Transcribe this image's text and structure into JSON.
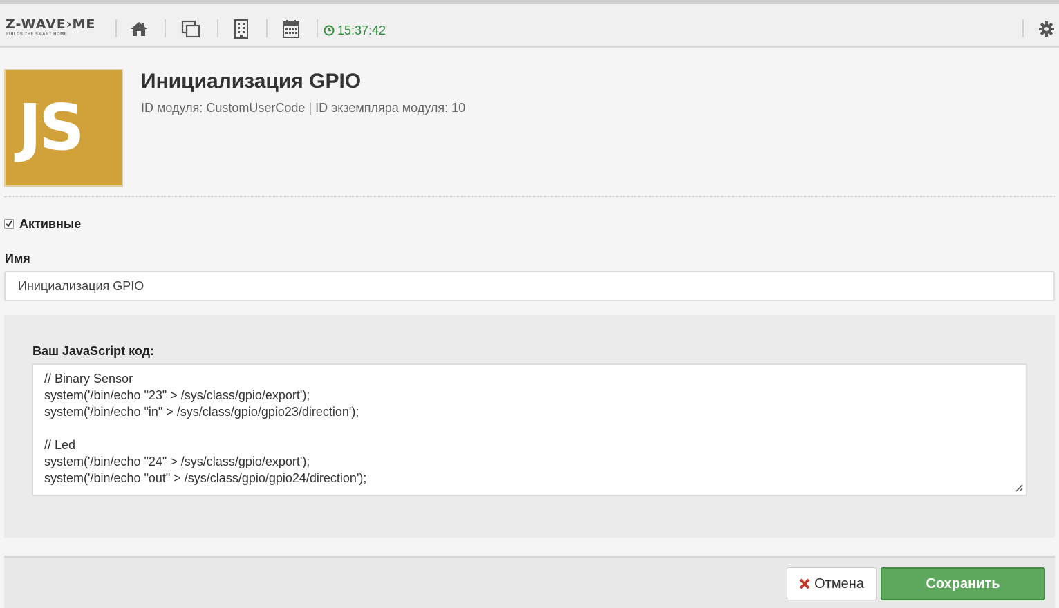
{
  "topbar": {
    "logo_text": "Z-WAVE›ME",
    "logo_tagline": "BUILDS THE SMART HOME",
    "clock_time": "15:37:42",
    "icons": [
      "home-icon",
      "windows-icon",
      "building-icon",
      "calendar-icon",
      "gear-icon"
    ]
  },
  "header": {
    "module_logo_text": "JS",
    "title": "Инициализация GPIO",
    "subtitle": "ID модуля: CustomUserCode | ID экземпляра модуля: 10"
  },
  "form": {
    "active_label": "Активные",
    "active_checked": true,
    "name_label": "Имя",
    "name_value": "Инициализация GPIO",
    "code_label": "Ваш JavaScript код:",
    "code_value": "// Binary Sensor\nsystem('/bin/echo \"23\" > /sys/class/gpio/export');\nsystem('/bin/echo \"in\" > /sys/class/gpio/gpio23/direction');\n\n// Led\nsystem('/bin/echo \"24\" > /sys/class/gpio/export');\nsystem('/bin/echo \"out\" > /sys/class/gpio/gpio24/direction');"
  },
  "footer": {
    "cancel_label": "Отмена",
    "save_label": "Сохранить"
  },
  "colors": {
    "clock": "#2e8b3a",
    "module_logo_bg": "#d1a13a",
    "save_button": "#5ea85e",
    "cancel_icon": "#c0392b"
  }
}
